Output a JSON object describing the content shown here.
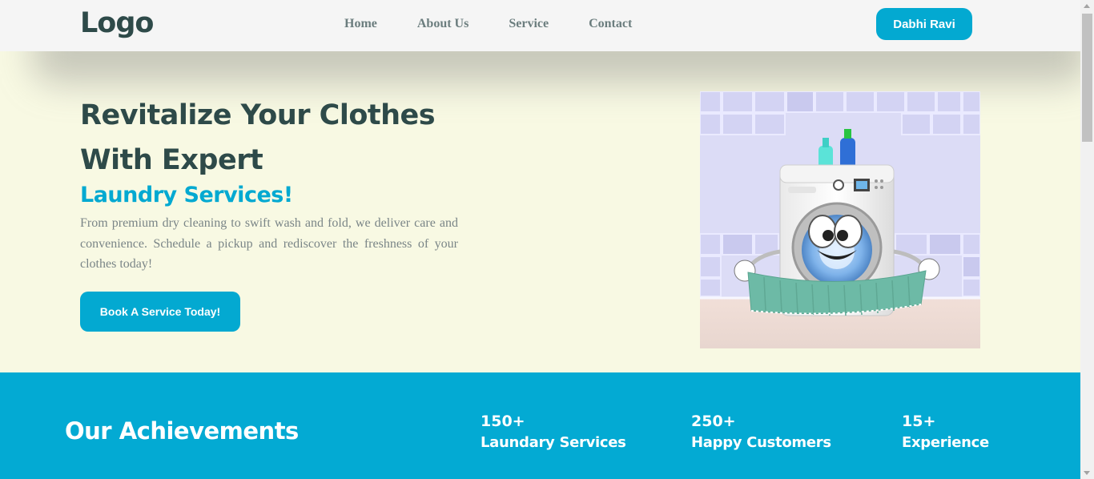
{
  "header": {
    "logo": "Logo",
    "nav": [
      "Home",
      "About Us",
      "Service",
      "Contact"
    ],
    "user_button": "Dabhi Ravi"
  },
  "hero": {
    "title_line1": "Revitalize Your Clothes",
    "title_line2": "With Expert",
    "subtitle": "Laundry Services!",
    "description": "From premium dry cleaning to swift wash and fold, we deliver care and convenience. Schedule a pickup and rediscover the freshness of your clothes today!",
    "cta": "Book A Service Today!",
    "image_icon": "washing-machine-illustration"
  },
  "achievements": {
    "title": "Our Achievements",
    "stats": [
      {
        "value": "150+",
        "label": "Laundary Services"
      },
      {
        "value": "250+",
        "label": "Happy Customers"
      },
      {
        "value": "15+",
        "label": "Experience"
      }
    ]
  },
  "colors": {
    "accent": "#03a9d1",
    "dark_text": "#2e4a49",
    "hero_bg": "#f8f9e3",
    "header_bg": "#f5f5f5"
  }
}
